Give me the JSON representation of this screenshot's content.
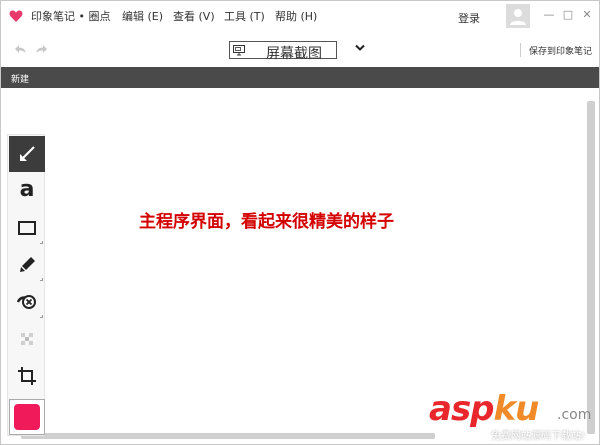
{
  "app": {
    "title": "印象笔记 • 圈点",
    "menus": [
      "编辑 (E)",
      "查看 (V)",
      "工具 (T)",
      "帮助 (H)"
    ],
    "login": "登录",
    "window_controls": {
      "minimize": "—",
      "maximize": "□",
      "close": "✕"
    }
  },
  "toolbar": {
    "image_title": "屏幕截图",
    "save_label": "保存到印象笔记",
    "icons": {
      "undo": "undo-icon",
      "redo": "redo-icon",
      "chevron": "chevron-down-icon"
    }
  },
  "subbar": {
    "new_label": "新建"
  },
  "canvas": {
    "annotation": "主程序界面，看起来很精美的样子"
  },
  "tools": [
    {
      "name": "arrow-tool",
      "icon": "arrow-icon",
      "active": true
    },
    {
      "name": "text-tool",
      "icon": "text-icon",
      "glyph": "a"
    },
    {
      "name": "rectangle-tool",
      "icon": "rectangle-icon"
    },
    {
      "name": "marker-tool",
      "icon": "marker-icon"
    },
    {
      "name": "stamp-tool",
      "icon": "stamp-icon"
    },
    {
      "name": "pixelate-tool",
      "icon": "pixelate-icon"
    },
    {
      "name": "crop-tool",
      "icon": "crop-icon"
    }
  ],
  "current_color": "#f0195a",
  "watermark": {
    "brand_asp": "asp",
    "brand_ku": "ku",
    "dotcom": ".com",
    "subtitle": "免费网站源码下载站!"
  }
}
